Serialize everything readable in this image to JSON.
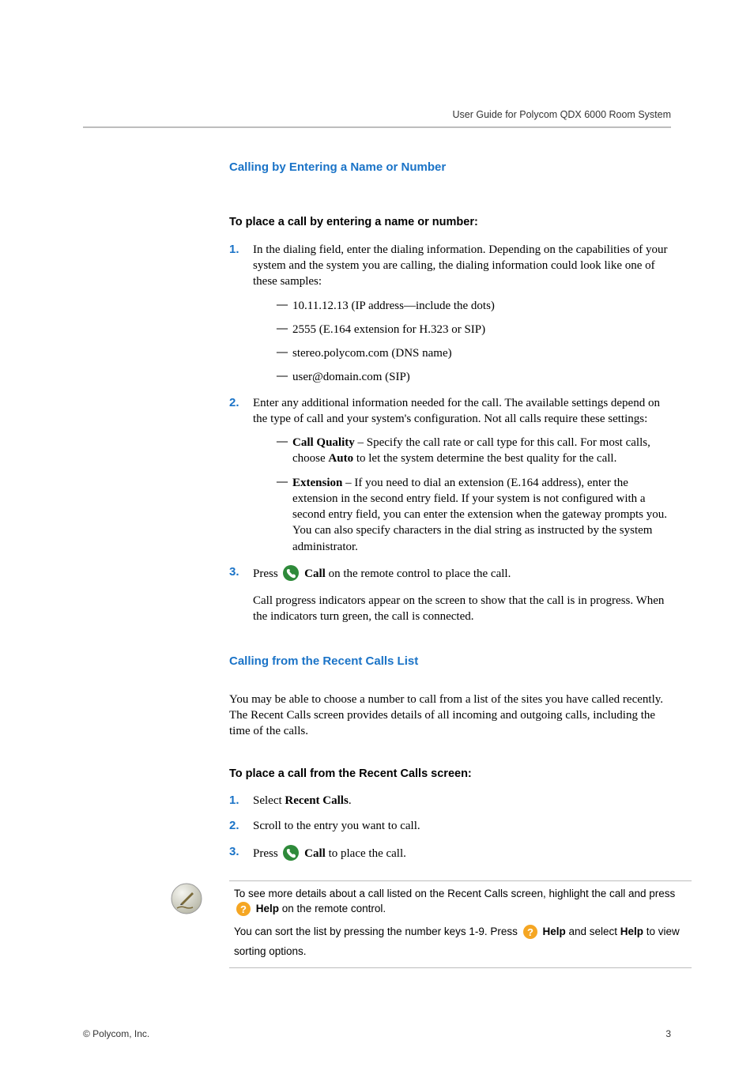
{
  "header": {
    "running": "User Guide for Polycom QDX 6000  Room System"
  },
  "sect1": {
    "heading": "Calling by Entering a Name or Number",
    "sub": "To place a call by entering a name or number:",
    "step1": "In the dialing field, enter the dialing information. Depending on the capabilities of your system and the system you are calling, the dialing information could look like one of these samples:",
    "step1_items": [
      "10.11.12.13 (IP address—include the dots)",
      "2555 (E.164 extension for H.323 or SIP)",
      "stereo.polycom.com (DNS name)",
      "user@domain.com (SIP)"
    ],
    "step2": "Enter any additional information needed for the call. The available settings depend on the type of call and your system's configuration. Not all calls require these settings:",
    "step2_items": [
      {
        "lead": "Call Quality",
        "rest": " – Specify the call rate or call type for this call. For most calls, choose ",
        "bold2": "Auto",
        "rest2": " to let the system determine the best quality for the call."
      },
      {
        "lead": "Extension",
        "rest": " – If you need to dial an extension (E.164 address), enter the extension in the second entry field. If your system is not configured with a second entry field, you can enter the extension when the gateway prompts you. You can also specify characters in the dial string as instructed by the system administrator."
      }
    ],
    "step3_a": "Press ",
    "step3_call": "Call",
    "step3_b": " on the remote control to place the call.",
    "step3_after": "Call progress indicators appear on the screen to show that the call is in progress. When the indicators turn green, the call is connected."
  },
  "sect2": {
    "heading": "Calling from the Recent Calls List",
    "intro": "You may be able to choose a number to call from a list of the sites you have called recently. The Recent Calls screen provides details of all incoming and outgoing calls, including the time of the calls.",
    "sub": "To place a call from the Recent Calls screen:",
    "step1_a": "Select ",
    "step1_b": "Recent Calls",
    "step1_c": ".",
    "step2": "Scroll to the entry you want to call.",
    "step3_a": "Press ",
    "step3_call": "Call",
    "step3_b": " to place the call."
  },
  "note": {
    "p1_a": "To see more details about a call listed on the Recent Calls screen, highlight the call and press ",
    "p1_help": "Help",
    "p1_b": " on the remote control.",
    "p2_a": "You can sort the list by pressing the number keys 1-9. Press ",
    "p2_help": "Help",
    "p2_b": " and select ",
    "p2_help2": "Help",
    "p2_c": " to view sorting options."
  },
  "footer": {
    "copyright": "© Polycom, Inc.",
    "page": "3"
  }
}
